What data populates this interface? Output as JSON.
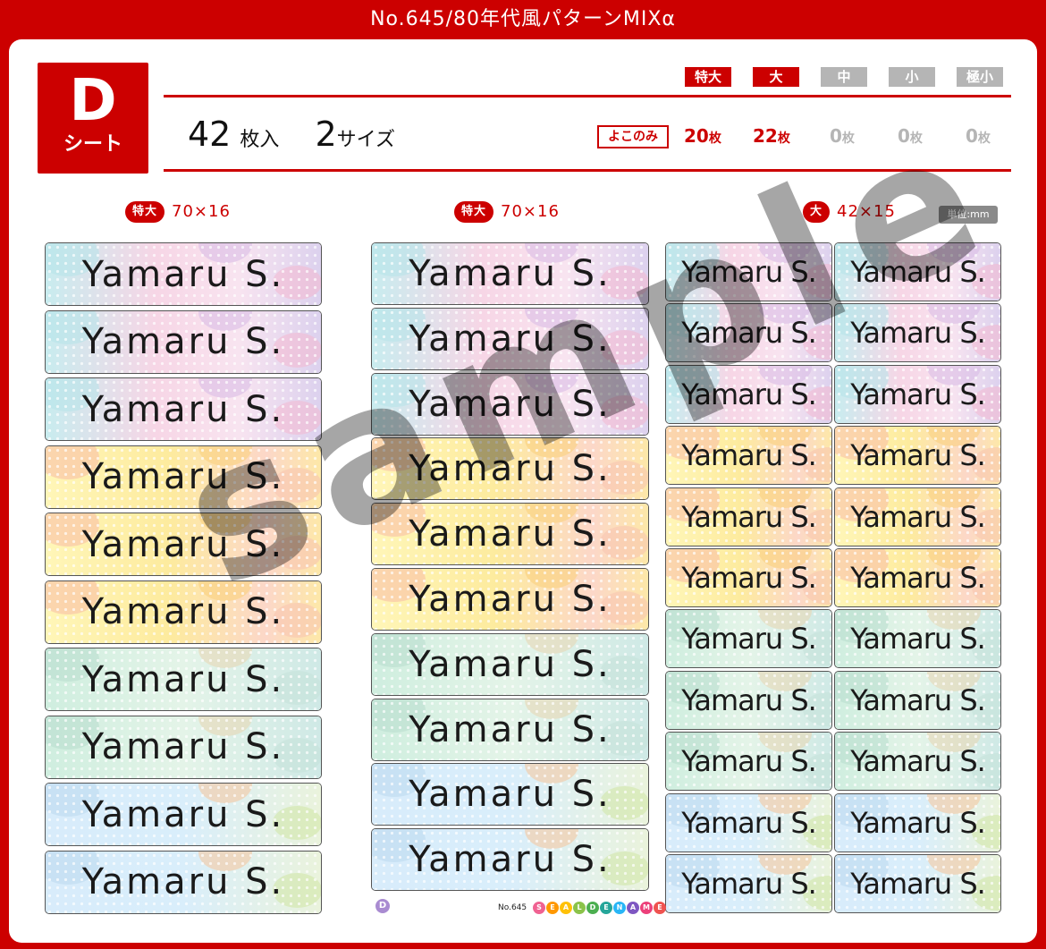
{
  "header": {
    "title": "No.645/80年代風パターンMIXα"
  },
  "sheet": {
    "letter": "D",
    "label": "シート"
  },
  "summary": {
    "count_num": "42",
    "count_unit": "枚入",
    "size_num": "2",
    "size_unit": "サイズ"
  },
  "size_tags": [
    {
      "label": "特大",
      "color": "#cc0000"
    },
    {
      "label": "大",
      "color": "#cc0000"
    },
    {
      "label": "中",
      "color": "#b5b5b5"
    },
    {
      "label": "小",
      "color": "#b5b5b5"
    },
    {
      "label": "極小",
      "color": "#b5b5b5"
    }
  ],
  "size_counts": [
    {
      "num": "20",
      "unit": "枚",
      "color": "#cc0000"
    },
    {
      "num": "22",
      "unit": "枚",
      "color": "#cc0000"
    },
    {
      "num": "0",
      "unit": "枚",
      "color": "#b5b5b5"
    },
    {
      "num": "0",
      "unit": "枚",
      "color": "#b5b5b5"
    },
    {
      "num": "0",
      "unit": "枚",
      "color": "#b5b5b5"
    }
  ],
  "yokonomi": "よこのみ",
  "columns": [
    {
      "pill": "特大",
      "dims": "70×16"
    },
    {
      "pill": "特大",
      "dims": "70×16"
    },
    {
      "pill": "大",
      "dims": "42×15"
    }
  ],
  "unit_note": "単位:mm",
  "label_text": "Yamaru S.",
  "watermark": "sample",
  "footer": {
    "badge": "D",
    "number": "No.645",
    "logo": "SEALDENAME"
  },
  "colors": {
    "brand": "#cc0000",
    "inactive": "#b5b5b5"
  }
}
